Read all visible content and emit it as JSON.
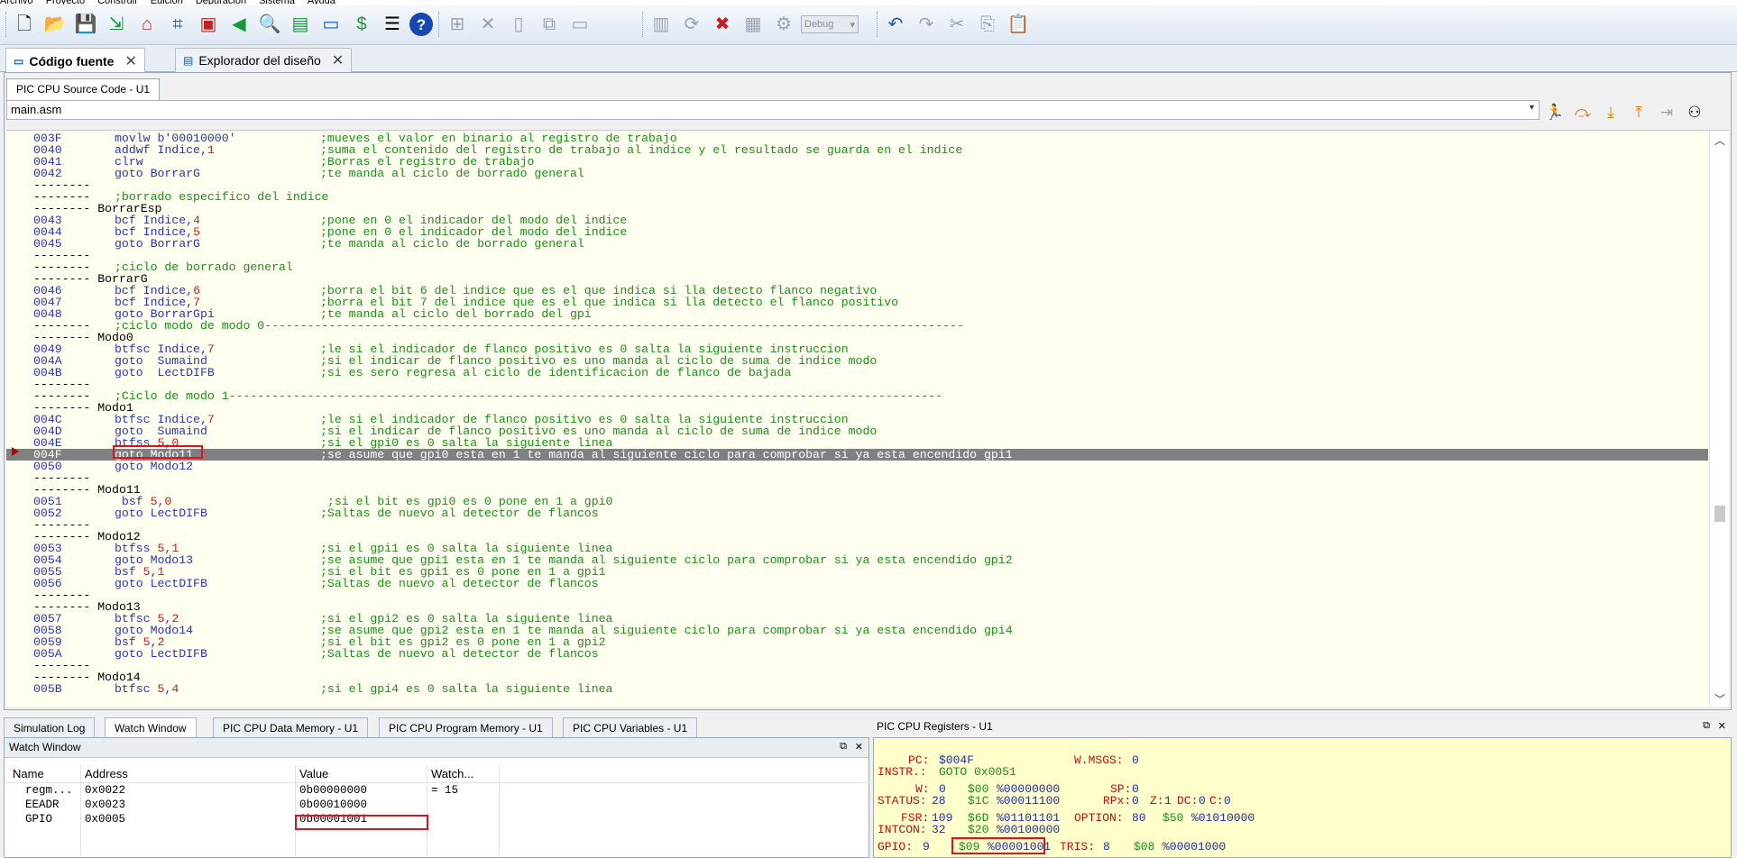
{
  "menu": [
    "Archivo",
    "Proyecto",
    "Construir",
    "Edición",
    "Depuración",
    "Sistema",
    "Ayuda"
  ],
  "toolbar": {
    "debug_config": "Debug"
  },
  "doc_tabs": [
    {
      "label": "Código fuente",
      "active": true
    },
    {
      "label": "Explorador del diseño",
      "active": false
    }
  ],
  "source": {
    "tab_label": "PIC CPU Source Code - U1",
    "file": "main.asm"
  },
  "code_lines": [
    {
      "a": "003F",
      "op": "movlw b'00010000'",
      "c": ";mueves el valor en binario al registro de trabajo"
    },
    {
      "a": "0040",
      "op": "addwf Indice,1",
      "c": ";suma el contenido del registro de trabajo al indice y el resultado se guarda en el indice"
    },
    {
      "a": "0041",
      "op": "clrw",
      "c": ";Borras el registro de trabajo"
    },
    {
      "a": "0042",
      "op": "goto BorrarG",
      "c": ";te manda al ciclo de borrado general"
    },
    {
      "a": "--------",
      "op": "",
      "c": ""
    },
    {
      "a": "--------",
      "op": "",
      "c": ";borrado especifico del indice",
      "wide": true
    },
    {
      "a": "-------- BorrarEsp",
      "op": "",
      "c": ""
    },
    {
      "a": "0043",
      "op": "bcf Indice,4",
      "c": ";pone en 0 el indicador del modo del indice"
    },
    {
      "a": "0044",
      "op": "bcf Indice,5",
      "c": ";pone en 0 el indicador del modo del indice"
    },
    {
      "a": "0045",
      "op": "goto BorrarG",
      "c": ";te manda al ciclo de borrado general"
    },
    {
      "a": "--------",
      "op": "",
      "c": ""
    },
    {
      "a": "--------",
      "op": "",
      "c": ";ciclo de borrado general",
      "wide": true
    },
    {
      "a": "-------- BorrarG",
      "op": "",
      "c": ""
    },
    {
      "a": "0046",
      "op": "bcf Indice,6",
      "c": ";borra el bit 6 del indice que es el que indica si lla detecto flanco negativo"
    },
    {
      "a": "0047",
      "op": "bcf Indice,7",
      "c": ";borra el bit 7 del indice que es el que indica si lla detecto el flanco positivo"
    },
    {
      "a": "0048",
      "op": "goto BorrarGpi",
      "c": ";te manda al ciclo del borrado del gpi"
    },
    {
      "a": "--------",
      "op": "",
      "c": ";ciclo modo de modo 0--------------------------------------------------------------------------------------------------",
      "wide": true
    },
    {
      "a": "-------- Modo0",
      "op": "",
      "c": ""
    },
    {
      "a": "0049",
      "op": "btfsc Indice,7",
      "c": ";le si el indicador de flanco positivo es 0 salta la siguiente instruccion"
    },
    {
      "a": "004A",
      "op": "goto  Sumaind",
      "c": ";si el indicar de flanco positivo es uno manda al ciclo de suma de indice modo"
    },
    {
      "a": "004B",
      "op": "goto  LectDIFB",
      "c": ";si es sero regresa al ciclo de identificacion de flanco de bajada"
    },
    {
      "a": "--------",
      "op": "",
      "c": ""
    },
    {
      "a": "--------",
      "op": "",
      "c": ";Ciclo de modo 1----------------------------------------------------------------------------------------------------",
      "wide": true
    },
    {
      "a": "-------- Modo1",
      "op": "",
      "c": ""
    },
    {
      "a": "004C",
      "op": "btfsc Indice,7",
      "c": ";le si el indicador de flanco positivo es 0 salta la siguiente instruccion"
    },
    {
      "a": "004D",
      "op": "goto  Sumaind",
      "c": ";si el indicar de flanco positivo es uno manda al ciclo de suma de indice modo"
    },
    {
      "a": "004E",
      "op": "btfss 5,0",
      "c": ";si el gpi0 es 0 salta la siguiente linea"
    },
    {
      "a": "004F",
      "op": "goto Modo11",
      "c": ";se asume que gpi0 esta en 1 te manda al siguiente ciclo para comprobar si ya esta encendido gpi1",
      "current": true
    },
    {
      "a": "0050",
      "op": "goto Modo12",
      "c": ""
    },
    {
      "a": "--------",
      "op": "",
      "c": ""
    },
    {
      "a": "-------- Modo11",
      "op": "",
      "c": ""
    },
    {
      "a": "0051",
      "op": " bsf 5,0",
      "c": " ;si el bit es gpi0 es 0 pone en 1 a gpi0"
    },
    {
      "a": "0052",
      "op": "goto LectDIFB",
      "c": ";Saltas de nuevo al detector de flancos"
    },
    {
      "a": "--------",
      "op": "",
      "c": ""
    },
    {
      "a": "-------- Modo12",
      "op": "",
      "c": ""
    },
    {
      "a": "0053",
      "op": "btfss 5,1",
      "c": ";si el gpi1 es 0 salta la siguiente linea"
    },
    {
      "a": "0054",
      "op": "goto Modo13",
      "c": ";se asume que gpi1 esta en 1 te manda al siguiente ciclo para comprobar si ya esta encendido gpi2"
    },
    {
      "a": "0055",
      "op": "bsf 5,1",
      "c": ";si el bit es gpi1 es 0 pone en 1 a gpi1"
    },
    {
      "a": "0056",
      "op": "goto LectDIFB",
      "c": ";Saltas de nuevo al detector de flancos"
    },
    {
      "a": "--------",
      "op": "",
      "c": ""
    },
    {
      "a": "-------- Modo13",
      "op": "",
      "c": ""
    },
    {
      "a": "0057",
      "op": "btfsc 5,2",
      "c": ";si el gpi2 es 0 salta la siguiente linea"
    },
    {
      "a": "0058",
      "op": "goto Modo14",
      "c": ";se asume que gpi2 esta en 1 te manda al siguiente ciclo para comprobar si ya esta encendido gpi4"
    },
    {
      "a": "0059",
      "op": "bsf 5,2",
      "c": ";si el bit es gpi2 es 0 pone en 1 a gpi2"
    },
    {
      "a": "005A",
      "op": "goto LectDIFB",
      "c": ";Saltas de nuevo al detector de flancos"
    },
    {
      "a": "--------",
      "op": "",
      "c": ""
    },
    {
      "a": "-------- Modo14",
      "op": "",
      "c": ""
    },
    {
      "a": "005B",
      "op": "btfsc 5,4",
      "c": ";si el gpi4 es 0 salta la siguiente linea"
    }
  ],
  "bottom_tabs": [
    {
      "label": "Simulation Log",
      "active": false
    },
    {
      "label": "Watch Window",
      "active": true
    },
    {
      "label": "PIC CPU Data Memory - U1",
      "active": false
    },
    {
      "label": "PIC CPU Program Memory - U1",
      "active": false
    },
    {
      "label": "PIC CPU Variables - U1",
      "active": false
    }
  ],
  "watch": {
    "title": "Watch Window",
    "columns": [
      "Name",
      "Address",
      "Value",
      "Watch..."
    ],
    "rows": [
      {
        "name": "regm...",
        "address": "0x0022",
        "value": "0b00000000",
        "watch": "= 15"
      },
      {
        "name": "EEADR",
        "address": "0x0023",
        "value": "0b00010000",
        "watch": ""
      },
      {
        "name": "GPIO",
        "address": "0x0005",
        "value": "0b00001001",
        "watch": ""
      }
    ]
  },
  "registers": {
    "title": "PIC CPU Registers - U1",
    "pc": "$004F",
    "instr": "GOTO 0x0051",
    "wmsgs": "0",
    "w_dec": "0",
    "w_hex": "$00",
    "w_bin": "%00000000",
    "sp": "0",
    "status_dec": "28",
    "status_hex": "$1C",
    "status_bin": "%00011100",
    "rpx": "0",
    "z": "1",
    "dc": "0",
    "c": "0",
    "fsr_dec": "109",
    "fsr_hex": "$6D",
    "fsr_bin": "%01101101",
    "option_dec": "80",
    "option_hex": "$50",
    "option_bin": "%01010000",
    "intcon_dec": "32",
    "intcon_hex": "$20",
    "intcon_bin": "%00100000",
    "gpio_dec": "9",
    "gpio_hex": "$09",
    "gpio_bin": "%00001001",
    "tris_dec": "8",
    "tris_hex": "$08",
    "tris_bin": "%00001000"
  }
}
